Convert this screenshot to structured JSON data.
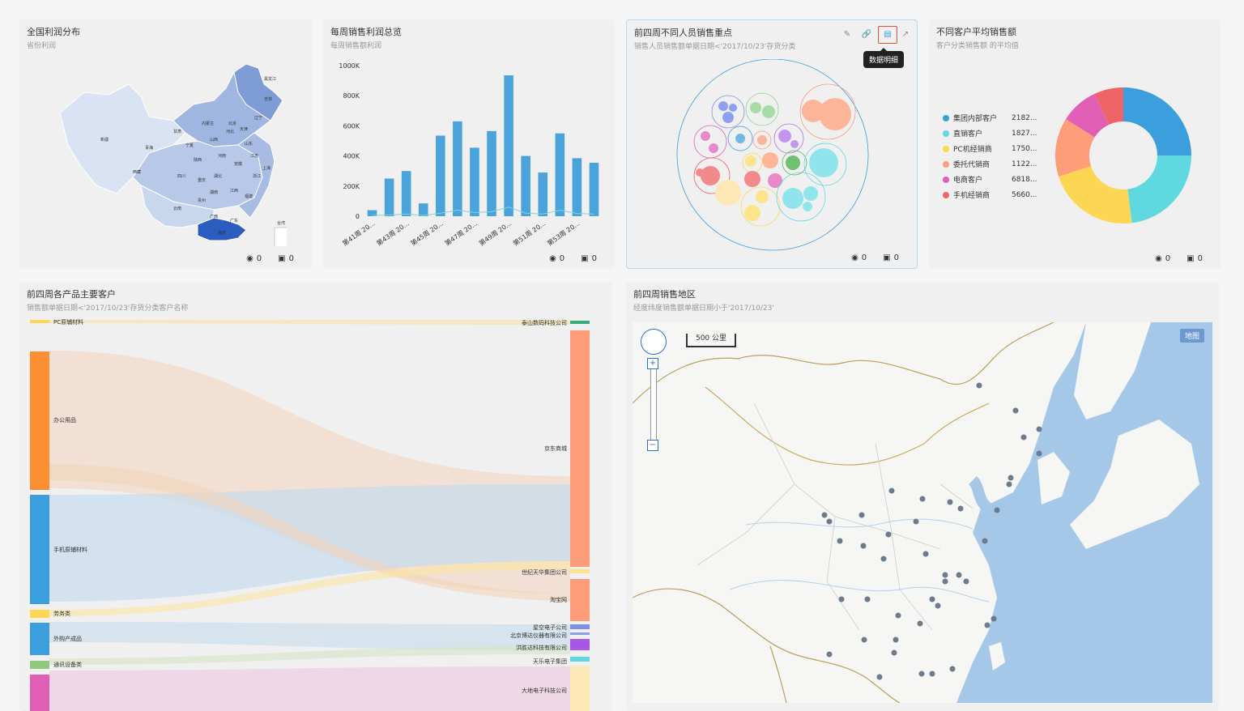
{
  "footer": {
    "views": "0",
    "comments": "0"
  },
  "cards": {
    "profit_map": {
      "title": "全国利润分布",
      "subtitle": "省份利润",
      "provinces": [
        "新疆",
        "西藏",
        "青海",
        "甘肃",
        "宁夏",
        "内蒙古",
        "陕西",
        "四川",
        "重庆",
        "云南",
        "贵州",
        "广西",
        "广东",
        "海南",
        "湖南",
        "湖北",
        "江西",
        "福建",
        "浙江",
        "上海",
        "江苏",
        "安徽",
        "山东",
        "河南",
        "山西",
        "河北",
        "北京",
        "天津",
        "辽宁",
        "吉林",
        "黑龙江",
        "台湾"
      ]
    },
    "weekly_sales": {
      "title": "每周销售利润总览",
      "subtitle": "每周销售额利润"
    },
    "staff_sales": {
      "title": "前四周不同人员销售重点",
      "subtitle": "销售人员销售额单据日期<'2017/10/23'存货分类",
      "tooltip": "数据明细"
    },
    "customer_avg": {
      "title": "不同客户平均销售额",
      "subtitle": "客户分类销售额 的平均值",
      "legend": [
        {
          "name": "集团内部客户",
          "value": "2182...",
          "color": "#3a9fdc"
        },
        {
          "name": "直销客户",
          "value": "1827...",
          "color": "#5fd8e0"
        },
        {
          "name": "PC机经销商",
          "value": "1750...",
          "color": "#fdd754"
        },
        {
          "name": "委托代销商",
          "value": "1122...",
          "color": "#fd9d7a"
        },
        {
          "name": "电商客户",
          "value": "6818...",
          "color": "#e15eb5"
        },
        {
          "name": "手机经销商",
          "value": "5660...",
          "color": "#ef6567"
        }
      ]
    },
    "sankey": {
      "title": "前四周各产品主要客户",
      "subtitle": "销售额单据日期<'2017/10/23'存货分类客户名称",
      "left_nodes": [
        "PC原辅材料",
        "办公用品",
        "手机原辅材料",
        "劳务类",
        "外购产成品",
        "通讯设备类"
      ],
      "right_nodes": [
        "泰山数码科技公司",
        "京东商城",
        "世纪天华集团公司",
        "淘宝网",
        "星空电子公司",
        "北京博达仪器有限公司",
        "洪胜达科技有限公司",
        "天乐电子集团",
        "大地电子科技公司"
      ]
    },
    "region_map": {
      "title": "前四周销售地区",
      "subtitle": "经度纬度销售额单据日期小于'2017/10/23'",
      "scale_label": "500 公里",
      "map_button": "地图"
    }
  },
  "chart_data": {
    "type": "bar",
    "categories": [
      "第41周 20...",
      "第42周 20...",
      "第43周 20...",
      "第44周 20...",
      "第45周 20...",
      "第46周 20...",
      "第47周 20...",
      "第48周 20...",
      "第49周 20...",
      "第50周 20...",
      "第51周 20...",
      "第52周 20...",
      "第53周 20...",
      "第54周 20..."
    ],
    "x_tick_labels": [
      "第41周 20...",
      "第43周 20...",
      "第45周 20...",
      "第47周 20...",
      "第49周 20...",
      "第51周 20...",
      "第53周 20..."
    ],
    "series": [
      {
        "name": "",
        "values": [
          40000,
          250000,
          300000,
          85000,
          535000,
          630000,
          455000,
          565000,
          935000,
          400000,
          290000,
          550000,
          385000,
          355000
        ]
      },
      {
        "name": "",
        "values": [
          5000,
          8000,
          15000,
          5000,
          20000,
          40000,
          25000,
          30000,
          60000,
          20000,
          15000,
          40000,
          18000,
          15000
        ]
      }
    ],
    "y_ticks": [
      "1000K",
      "800K",
      "600K",
      "400K",
      "200K",
      "0"
    ],
    "ylim": [
      0,
      1000000
    ],
    "colors": {
      "bar": "#4ba3db",
      "line": "#7dd6d8"
    }
  }
}
